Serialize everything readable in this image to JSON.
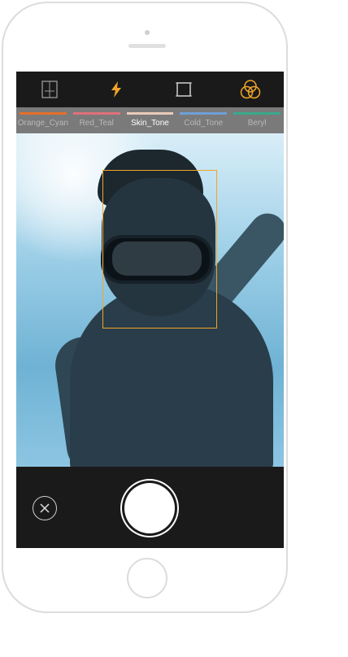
{
  "toolbar": {
    "icons": [
      "swap-frame-icon",
      "flash-icon",
      "square-frame-icon",
      "color-filter-icon"
    ],
    "accent_color": "#f0a52a"
  },
  "filters": [
    {
      "label": "Orange_Cyan",
      "color": "#e46f2b"
    },
    {
      "label": "Red_Teal",
      "color": "#e0707a"
    },
    {
      "label": "Skin_Tone",
      "color": "#e8cbb8"
    },
    {
      "label": "Cold_Tone",
      "color": "#6f9fd6"
    },
    {
      "label": "Beryl",
      "color": "#3aa88a"
    }
  ],
  "selected_filter": "Skin_Tone",
  "focus_box_color": "#f0a52a",
  "controls": {
    "cancel_icon": "close-icon",
    "shutter": "shutter-button"
  }
}
